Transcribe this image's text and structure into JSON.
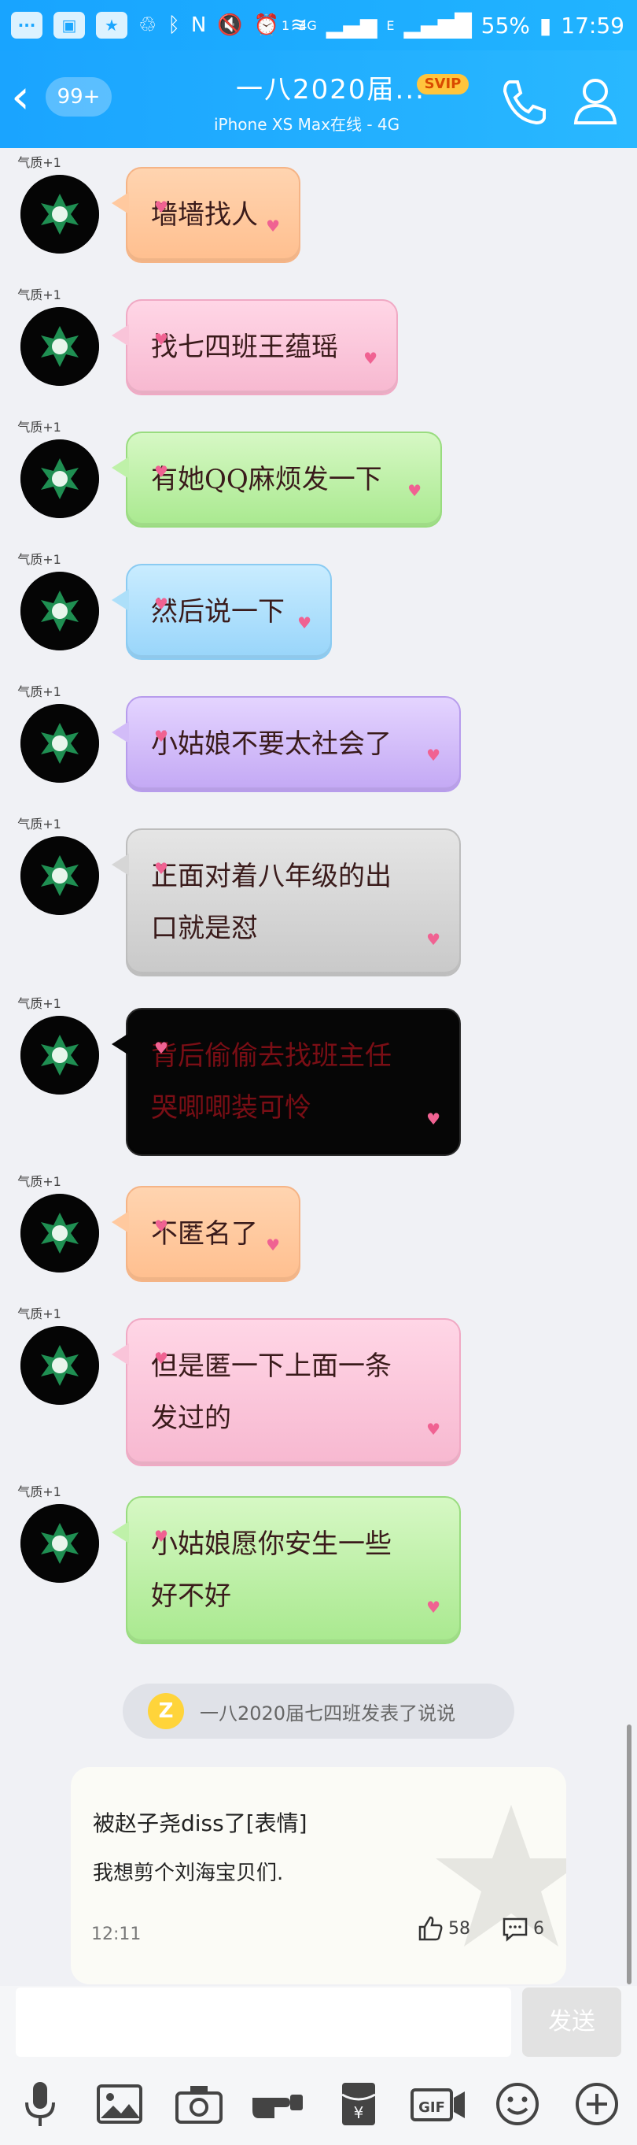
{
  "status_bar": {
    "network": "4G",
    "network_small": "E",
    "sim_slot": "1",
    "battery": "55%",
    "time": "17:59"
  },
  "header": {
    "back_badge": "99+",
    "title": "一八2020届...",
    "vip_badge": "SVIP",
    "subtitle": "iPhone XS Max在线 - 4G"
  },
  "avatar_tag": "气质+1",
  "messages": [
    {
      "lines": [
        "墙墙找人"
      ],
      "color": "orange"
    },
    {
      "lines": [
        "找七四班王蕴瑶"
      ],
      "color": "pink"
    },
    {
      "lines": [
        "有她QQ麻烦发一下"
      ],
      "color": "green"
    },
    {
      "lines": [
        "然后说一下"
      ],
      "color": "blue"
    },
    {
      "lines": [
        "小姑娘不要太社会了"
      ],
      "color": "purple"
    },
    {
      "lines": [
        "正面对着八年级的出",
        "口就是怼"
      ],
      "color": "gray"
    },
    {
      "lines": [
        "背后偷偷去找班主任",
        "哭唧唧装可怜"
      ],
      "color": "black"
    },
    {
      "lines": [
        "不匿名了"
      ],
      "color": "orange"
    },
    {
      "lines": [
        "但是匿一下上面一条",
        "发过的"
      ],
      "color": "pink"
    },
    {
      "lines": [
        "小姑娘愿你安生一些",
        "好不好"
      ],
      "color": "green"
    }
  ],
  "notice": {
    "icon_letter": "Z",
    "text": "一八2020届七四班发表了说说"
  },
  "post_card": {
    "line1": "被赵子尧diss了[表情]",
    "line2": "我想剪个刘海宝贝们.",
    "time": "12:11",
    "likes": "58",
    "comments": "6"
  },
  "input": {
    "send_label": "发送"
  },
  "toolbar_icons": [
    "mic-icon",
    "image-icon",
    "camera-icon",
    "hand-icon",
    "red-packet-icon",
    "gif-icon",
    "emoji-icon",
    "plus-icon"
  ],
  "colors": {
    "header_blue": "#1aa6ff",
    "vip_gold": "#ffc53d"
  }
}
